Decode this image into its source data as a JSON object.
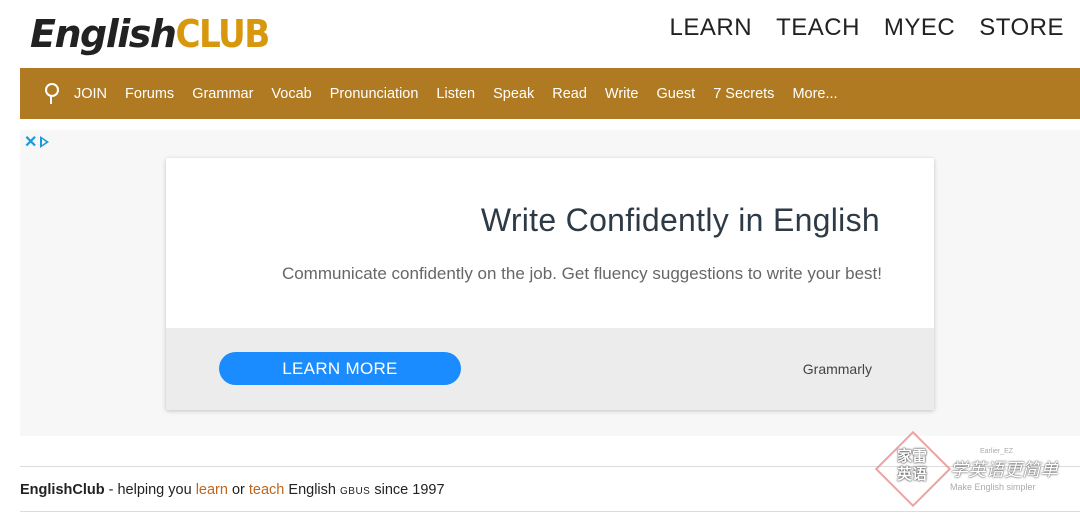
{
  "header": {
    "logo": {
      "part1": "English",
      "part2": "CLUB"
    },
    "nav": [
      "LEARN",
      "TEACH",
      "MYEC",
      "STORE"
    ]
  },
  "navbar": {
    "search_icon": "search-icon",
    "items": [
      "JOIN",
      "Forums",
      "Grammar",
      "Vocab",
      "Pronunciation",
      "Listen",
      "Speak",
      "Read",
      "Write",
      "Guest",
      "7 Secrets",
      "More..."
    ]
  },
  "ad": {
    "choices_close": "✕",
    "title": "Write Confidently in English",
    "subtitle": "Communicate confidently on the job. Get fluency suggestions to write your best!",
    "cta": "LEARN MORE",
    "brand": "Grammarly"
  },
  "tagline": {
    "site": "EnglishClub",
    "t1": " - helping you ",
    "learn": "learn",
    "t2": " or ",
    "teach": "teach",
    "t3": " English ",
    "gbus": "GBUS",
    "t4": " since 1997"
  },
  "watermark": {
    "badge": "家雷英语",
    "script": "学英语更简单",
    "handle": "Earlier_EZ",
    "slogan": "Make English simpler"
  },
  "colors": {
    "brown_bar": "#af7a22",
    "logo_gold": "#d8980e",
    "cta_blue": "#1a8cff",
    "link_orange": "#c0661a"
  }
}
